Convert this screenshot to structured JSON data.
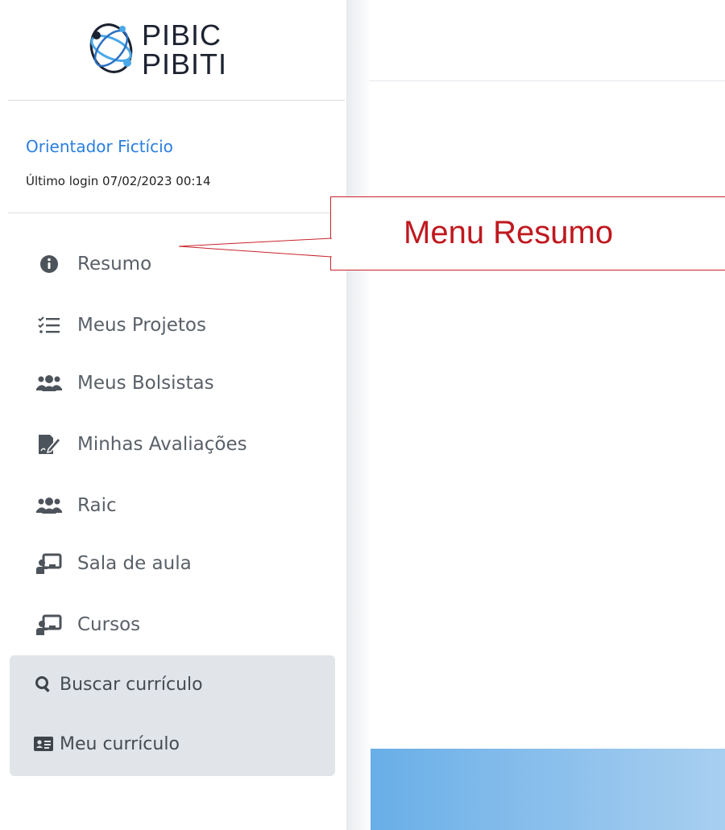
{
  "logo": {
    "line1": "PIBIC",
    "line2": "PIBITI"
  },
  "user": {
    "name": "Orientador Fictício",
    "last_login": "Último login 07/02/2023 00:14"
  },
  "nav": {
    "items": [
      {
        "label": "Resumo",
        "icon": "info-circle-icon"
      },
      {
        "label": "Meus Projetos",
        "icon": "tasks-list-icon"
      },
      {
        "label": "Meus Bolsistas",
        "icon": "users-icon"
      },
      {
        "label": "Minhas Avaliações",
        "icon": "file-signature-icon"
      },
      {
        "label": "Raic",
        "icon": "users-icon"
      },
      {
        "label": "Sala de aula",
        "icon": "chalkboard-teacher-icon"
      },
      {
        "label": "Cursos",
        "icon": "chalkboard-teacher-icon"
      }
    ]
  },
  "curriculum": {
    "search": {
      "label": "Buscar currículo",
      "icon": "search-icon"
    },
    "mine": {
      "label": "Meu currículo",
      "icon": "id-card-icon"
    }
  },
  "annotation": {
    "label": "Menu Resumo"
  },
  "colors": {
    "link": "#2a7ee0",
    "annotation": "#c0181f",
    "band": "#4a9fe3",
    "panel": "#e1e5e9"
  }
}
